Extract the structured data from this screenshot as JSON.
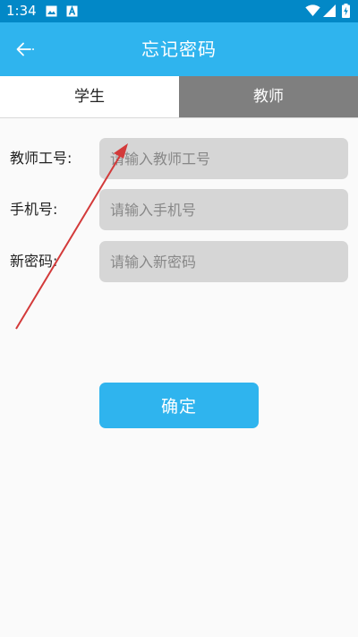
{
  "status_bar": {
    "time": "1:34",
    "icons": [
      "image-icon",
      "a-notification-icon",
      "wifi-icon",
      "signal-icon",
      "battery-charging-icon"
    ],
    "background": "#0288c7"
  },
  "app_bar": {
    "title": "忘记密码",
    "back_icon": "arrow-left-icon",
    "background": "#2fb4ee"
  },
  "tabs": [
    {
      "label": "学生",
      "active": true
    },
    {
      "label": "教师",
      "active": false
    }
  ],
  "form": {
    "fields": [
      {
        "label": "教师工号:",
        "placeholder": "请输入教师工号",
        "value": ""
      },
      {
        "label": "手机号:",
        "placeholder": "请输入手机号",
        "value": ""
      },
      {
        "label": "新密码:",
        "placeholder": "请输入新密码",
        "value": ""
      }
    ],
    "input_background": "#d6d6d6"
  },
  "confirm_button": {
    "label": "确定",
    "background": "#2fb4ee"
  },
  "annotation": {
    "type": "arrow",
    "color": "#d33a3a"
  }
}
